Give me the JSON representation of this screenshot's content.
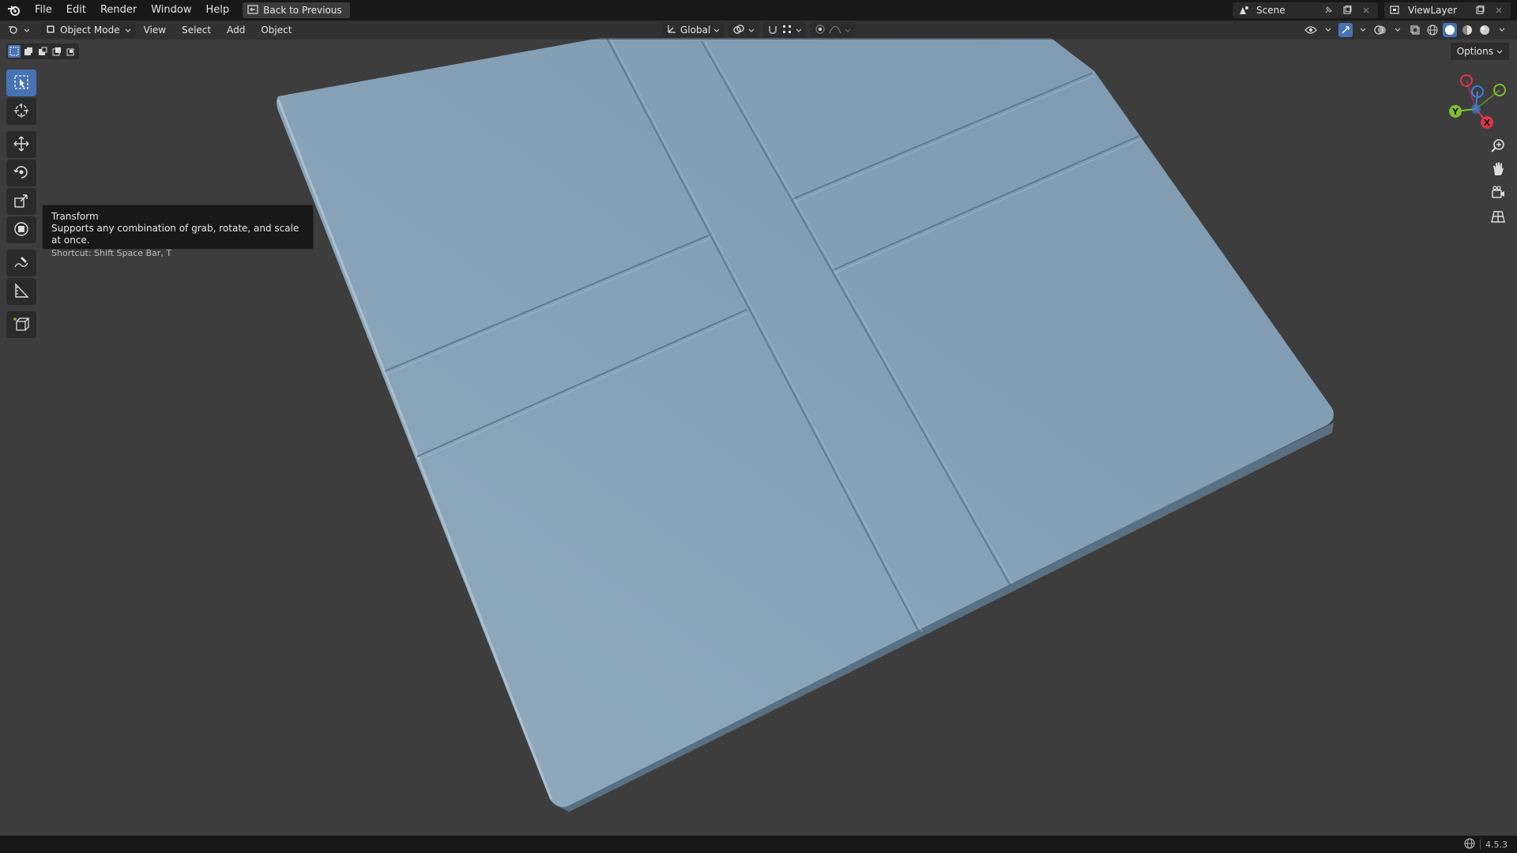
{
  "menubar": {
    "items": [
      "File",
      "Edit",
      "Render",
      "Window",
      "Help"
    ],
    "back_button": "Back to Previous",
    "scene_name": "Scene",
    "view_layer": "ViewLayer"
  },
  "viewport_header": {
    "mode": "Object Mode",
    "menus": [
      "View",
      "Select",
      "Add",
      "Object"
    ],
    "orientation": "Global",
    "options_label": "Options"
  },
  "tooltip": {
    "title": "Transform",
    "description": "Supports any combination of grab, rotate, and scale at once.",
    "shortcut": "Shortcut: Shift Space Bar, T"
  },
  "gizmo": {
    "axis_y": "Y",
    "axis_x": "X",
    "axis_z": "Z",
    "colors": {
      "x": "#e0344c",
      "y": "#7fbf2a",
      "z": "#3d7fdf"
    }
  },
  "statusbar": {
    "version": "4.5.3"
  },
  "colors": {
    "accent": "#4772b3",
    "mesh": "#8aa6bc",
    "background": "#3d3d3d"
  }
}
